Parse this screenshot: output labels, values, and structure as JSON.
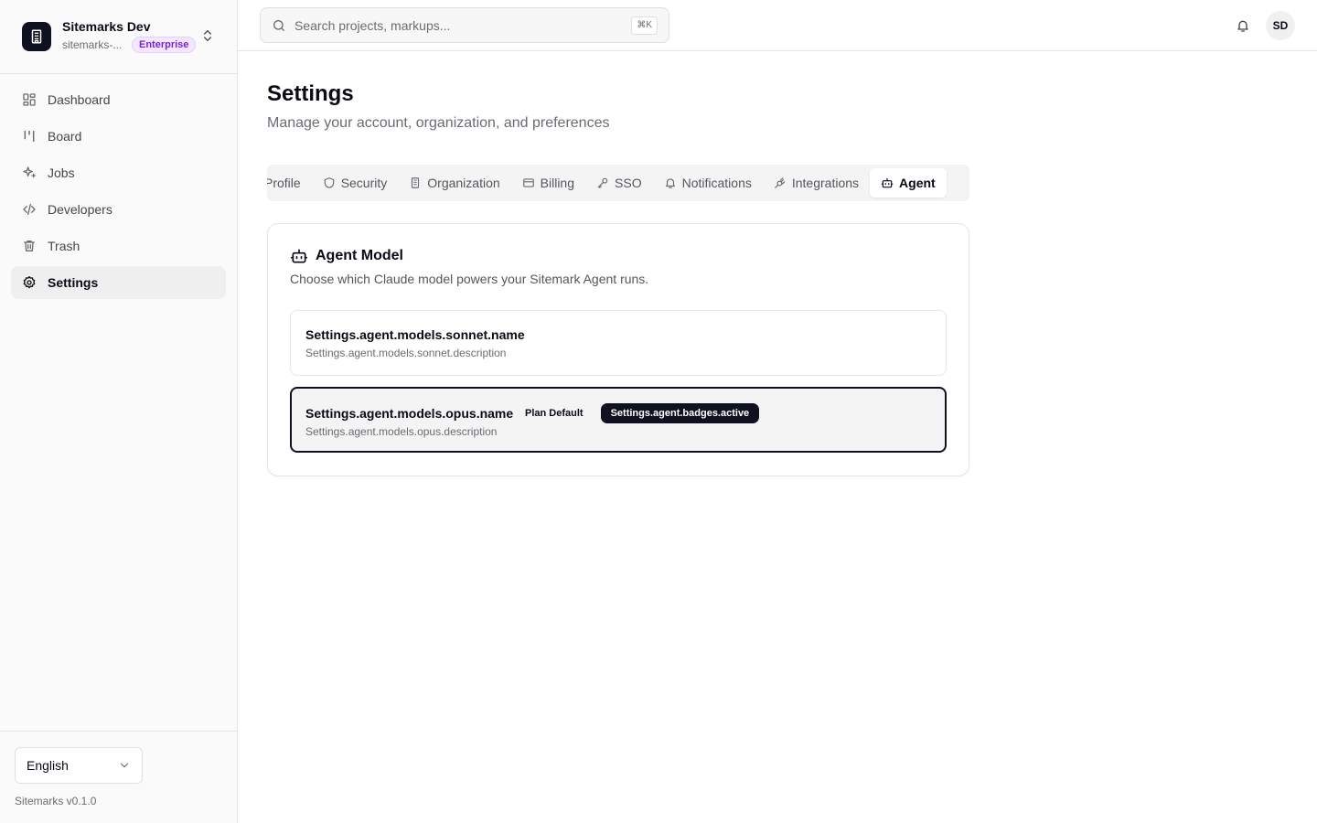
{
  "org": {
    "name": "Sitemarks Dev",
    "slug": "sitemarks-...",
    "plan_badge": "Enterprise"
  },
  "sidebar": {
    "items": [
      {
        "label": "Dashboard",
        "icon": "dashboard-icon"
      },
      {
        "label": "Board",
        "icon": "board-icon"
      },
      {
        "label": "Jobs",
        "icon": "sparkles-icon"
      },
      {
        "label": "Developers",
        "icon": "code-icon"
      },
      {
        "label": "Trash",
        "icon": "trash-icon"
      },
      {
        "label": "Settings",
        "icon": "gear-icon",
        "active": true
      }
    ],
    "language": "English",
    "version": "Sitemarks v0.1.0"
  },
  "topbar": {
    "search_placeholder": "Search projects, markups...",
    "shortcut": "⌘K",
    "avatar_initials": "SD"
  },
  "page": {
    "title": "Settings",
    "subtitle": "Manage your account, organization, and preferences"
  },
  "tabs": [
    {
      "label": "Profile",
      "icon": "user-icon"
    },
    {
      "label": "Security",
      "icon": "shield-icon"
    },
    {
      "label": "Organization",
      "icon": "building-icon"
    },
    {
      "label": "Billing",
      "icon": "credit-card-icon"
    },
    {
      "label": "SSO",
      "icon": "key-icon"
    },
    {
      "label": "Notifications",
      "icon": "bell-icon"
    },
    {
      "label": "Integrations",
      "icon": "plug-icon"
    },
    {
      "label": "Agent",
      "icon": "bot-icon",
      "active": true
    }
  ],
  "agent": {
    "title": "Agent Model",
    "description": "Choose which Claude model powers your Sitemark Agent runs.",
    "models": [
      {
        "name": "Settings.agent.models.sonnet.name",
        "description": "Settings.agent.models.sonnet.description"
      },
      {
        "name": "Settings.agent.models.opus.name",
        "description": "Settings.agent.models.opus.description",
        "default_badge": "Plan Default",
        "active_badge": "Settings.agent.badges.active",
        "selected": true
      }
    ]
  },
  "colors": {
    "primary": "#0f1020",
    "enterprise_badge": "#7e22ce",
    "active_nav_bg": "#efefef"
  }
}
